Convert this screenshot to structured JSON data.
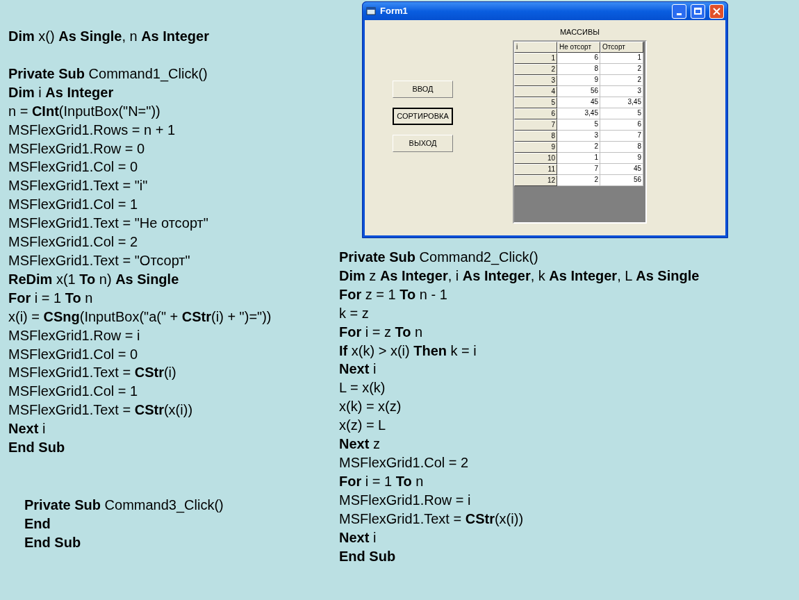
{
  "declaration": [
    "**Dim** x() **As Single**, n **As Integer**"
  ],
  "command1_sub": [
    "**Private Sub** Command1_Click()",
    "**Dim** i **As Integer**",
    "n = **CInt**(InputBox(\"N=\"))",
    "MSFlexGrid1.Rows = n + 1",
    "MSFlexGrid1.Row = 0",
    "MSFlexGrid1.Col = 0",
    "MSFlexGrid1.Text = \"i\"",
    "MSFlexGrid1.Col = 1",
    "MSFlexGrid1.Text = \"Не отсорт\"",
    "MSFlexGrid1.Col = 2",
    "MSFlexGrid1.Text = \"Отсорт\"",
    "**ReDim** x(1 **To** n) **As Single**",
    "**For** i = 1 **To** n",
    "x(i) = **CSng**(InputBox(\"a(\" + **CStr**(i) + \")=\"))",
    "MSFlexGrid1.Row = i",
    "MSFlexGrid1.Col = 0",
    "MSFlexGrid1.Text = **CStr**(i)",
    "MSFlexGrid1.Col = 1",
    "MSFlexGrid1.Text = **CStr**(x(i))",
    "**Next** i",
    "**End Sub**"
  ],
  "command3_sub": [
    "**Private Sub** Command3_Click()",
    "**End**",
    "**End Sub**"
  ],
  "form": {
    "title": "Form1",
    "buttons": [
      {
        "label": "ВВОД",
        "focused": false
      },
      {
        "label": "СОРТИРОВКА",
        "focused": true
      },
      {
        "label": "ВЫХОД",
        "focused": false
      }
    ],
    "grid": {
      "caption": "МАССИВЫ",
      "columns": [
        "i",
        "Не отсорт",
        "Отсорт"
      ],
      "rows": [
        [
          "1",
          "6",
          "1"
        ],
        [
          "2",
          "8",
          "2"
        ],
        [
          "3",
          "9",
          "2"
        ],
        [
          "4",
          "56",
          "3"
        ],
        [
          "5",
          "45",
          "3,45"
        ],
        [
          "6",
          "3,45",
          "5"
        ],
        [
          "7",
          "5",
          "6"
        ],
        [
          "8",
          "3",
          "7"
        ],
        [
          "9",
          "2",
          "8"
        ],
        [
          "10",
          "1",
          "9"
        ],
        [
          "11",
          "7",
          "45"
        ],
        [
          "12",
          "2",
          "56"
        ]
      ]
    }
  },
  "command2_sub": [
    "**Private Sub** Command2_Click()",
    "**Dim** z **As Integer**, i **As Integer**, k **As Integer**, L **As Single**",
    "**For** z = 1 **To** n - 1",
    "k = z",
    "**For** i = z **To** n",
    "**If** x(k) > x(i) **Then** k = i",
    "**Next** i",
    "L = x(k)",
    "x(k) = x(z)",
    "x(z) = L",
    "**Next** z",
    "MSFlexGrid1.Col = 2",
    "**For** i = 1 **To** n",
    "MSFlexGrid1.Row = i",
    "MSFlexGrid1.Text = **CStr**(x(i))",
    "**Next** i",
    "**End Sub**"
  ]
}
